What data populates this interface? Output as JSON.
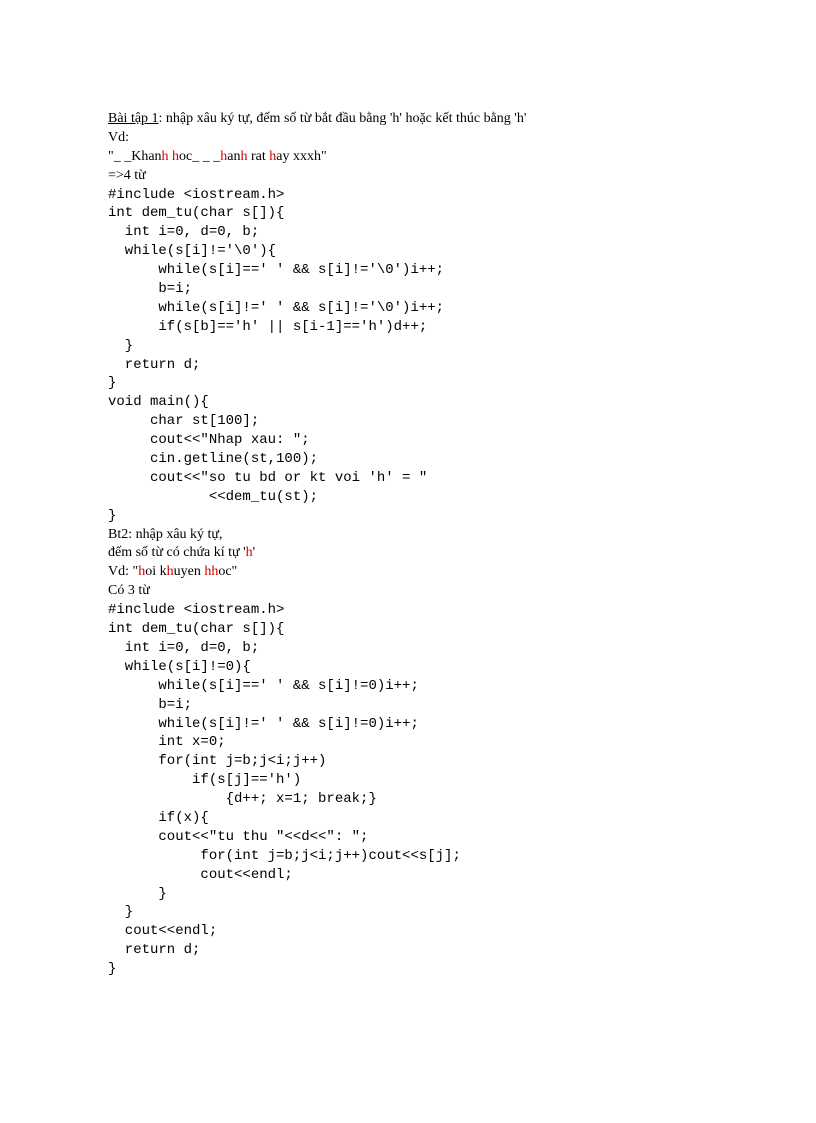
{
  "bt1": {
    "title": "Bài tập 1",
    "desc": ": nhập xâu ký tự, đếm số từ bắt đầu bằng 'h' hoặc kết thúc bằng 'h'",
    "vd_label": "Vd:",
    "vd_open": "\"_ _Khan",
    "vd_h1": "h",
    "vd_sp1": " ",
    "vd_h2": "h",
    "vd_oc": "oc_ _ _",
    "vd_h3": "h",
    "vd_an": "an",
    "vd_h4": "h",
    "vd_rat": " rat ",
    "vd_h5": "h",
    "vd_end": "ay xxxh\"",
    "result": "=>4 từ",
    "c1": "#include <iostream.h>",
    "c2": "int dem_tu(char s[]){",
    "c3": "  int i=0, d=0, b;",
    "c4": "  while(s[i]!='\\0'){",
    "c5": "      while(s[i]==' ' && s[i]!='\\0')i++;",
    "c6": "      b=i;",
    "c7": "      while(s[i]!=' ' && s[i]!='\\0')i++;",
    "c8": "      if(s[b]=='h' || s[i-1]=='h')d++;",
    "c9": "  }",
    "c10": "  return d;",
    "c11": "}",
    "c12": "void main(){",
    "c13": "     char st[100];",
    "c14": "     cout<<\"Nhap xau: \";",
    "c15": "     cin.getline(st,100);",
    "c16": "     cout<<\"so tu bd or kt voi 'h' = \"",
    "c17": "            <<dem_tu(st);",
    "c18": "}"
  },
  "bt2": {
    "title": "Bt2: nhập xâu ký tự,",
    "desc": "đếm số từ có chứa kí tự '",
    "hchar": "h",
    "desc_end": "'",
    "vd_label": "Vd: \"",
    "v_h1": "h",
    "v_oi": "oi k",
    "v_h2": "h",
    "v_uyen": "uyen ",
    "v_h3": "hh",
    "v_oc": "oc\"",
    "count": "Có 3 từ",
    "c1": "#include <iostream.h>",
    "c2": "int dem_tu(char s[]){",
    "c3": "  int i=0, d=0, b;",
    "c4": "  while(s[i]!=0){",
    "c5": "      while(s[i]==' ' && s[i]!=0)i++;",
    "c6": "      b=i;",
    "c7": "      while(s[i]!=' ' && s[i]!=0)i++;",
    "c8": "      int x=0;",
    "c9": "      for(int j=b;j<i;j++)",
    "c10": "          if(s[j]=='h')",
    "c11": "              {d++; x=1; break;}",
    "c12": "      if(x){",
    "c13": "      cout<<\"tu thu \"<<d<<\": \";",
    "c14": "           for(int j=b;j<i;j++)cout<<s[j];",
    "c15": "           cout<<endl;",
    "c16": "      }",
    "c17": "  }",
    "c18": "  cout<<endl;",
    "c19": "  return d;",
    "c20": "}"
  }
}
